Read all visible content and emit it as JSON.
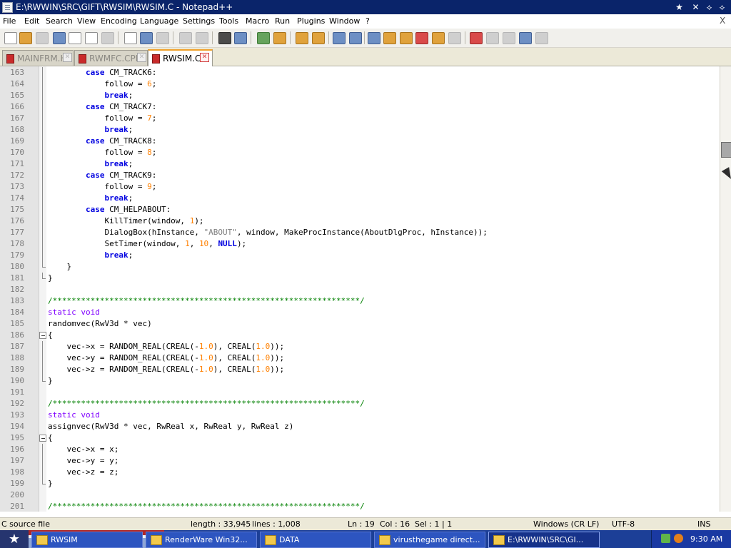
{
  "window": {
    "title": "E:\\RWWIN\\SRC\\GIFT\\RWSIM\\RWSIM.C - Notepad++",
    "controls": [
      "★",
      "✕",
      "⟡",
      "⟡",
      "✕"
    ]
  },
  "menu": {
    "items": [
      "File",
      "Edit",
      "Search",
      "View",
      "Encoding",
      "Language",
      "Settings",
      "Tools",
      "Macro",
      "Run",
      "Plugins",
      "Window",
      "?"
    ],
    "close": "X"
  },
  "toolbar": {
    "icons": [
      "new-file-icon",
      "open-file-icon",
      "save-icon",
      "save-all-icon",
      "close-icon",
      "close-all-icon",
      "print-icon",
      "cut-icon",
      "copy-icon",
      "paste-icon",
      "undo-icon",
      "redo-icon",
      "find-icon",
      "replace-icon",
      "zoom-in-icon",
      "zoom-out-icon",
      "sync-vertical-icon",
      "sync-horizontal-icon",
      "word-wrap-icon",
      "show-all-chars-icon",
      "indent-guide-icon",
      "user-lang-icon",
      "doc-map-icon",
      "function-list-icon",
      "folder-icon",
      "monitoring-icon",
      "record-macro-icon",
      "stop-macro-icon",
      "play-macro-icon",
      "run-macro-multiple-icon",
      "save-macro-icon"
    ]
  },
  "tabs": [
    {
      "label": "MAINFRM.H",
      "active": false
    },
    {
      "label": "RWMFC.CPP",
      "active": false
    },
    {
      "label": "RWSIM.C",
      "active": true
    }
  ],
  "editor": {
    "lines": [
      {
        "n": "163",
        "code": "case CM_TRACK6:"
      },
      {
        "n": "164",
        "code": "follow = 6;"
      },
      {
        "n": "165",
        "code": "break;"
      },
      {
        "n": "166",
        "code": "case CM_TRACK7:"
      },
      {
        "n": "167",
        "code": "follow = 7;"
      },
      {
        "n": "168",
        "code": "break;"
      },
      {
        "n": "169",
        "code": "case CM_TRACK8:"
      },
      {
        "n": "170",
        "code": "follow = 8;"
      },
      {
        "n": "171",
        "code": "break;"
      },
      {
        "n": "172",
        "code": "case CM_TRACK9:"
      },
      {
        "n": "173",
        "code": "follow = 9;"
      },
      {
        "n": "174",
        "code": "break;"
      },
      {
        "n": "175",
        "code": "case CM_HELPABOUT:"
      },
      {
        "n": "176",
        "code": "KillTimer(window, 1);"
      },
      {
        "n": "177",
        "code": "DialogBox(hInstance, \"ABOUT\", window, MakeProcInstance(AboutDlgProc, hInstance));"
      },
      {
        "n": "178",
        "code": "SetTimer(window, 1, 10, NULL);"
      },
      {
        "n": "179",
        "code": "break;"
      },
      {
        "n": "180",
        "code": "}"
      },
      {
        "n": "181",
        "code": "}"
      },
      {
        "n": "182",
        "code": ""
      },
      {
        "n": "183",
        "code": "/*****************************************************************/"
      },
      {
        "n": "184",
        "code": "static void"
      },
      {
        "n": "185",
        "code": "randomvec(RwV3d * vec)"
      },
      {
        "n": "186",
        "code": "{"
      },
      {
        "n": "187",
        "code": "vec->x = RANDOM_REAL(CREAL(-1.0), CREAL(1.0));"
      },
      {
        "n": "188",
        "code": "vec->y = RANDOM_REAL(CREAL(-1.0), CREAL(1.0));"
      },
      {
        "n": "189",
        "code": "vec->z = RANDOM_REAL(CREAL(-1.0), CREAL(1.0));"
      },
      {
        "n": "190",
        "code": "}"
      },
      {
        "n": "191",
        "code": ""
      },
      {
        "n": "192",
        "code": "/*****************************************************************/"
      },
      {
        "n": "193",
        "code": "static void"
      },
      {
        "n": "194",
        "code": "assignvec(RwV3d * vec, RwReal x, RwReal y, RwReal z)"
      },
      {
        "n": "195",
        "code": "{"
      },
      {
        "n": "196",
        "code": "vec->x = x;"
      },
      {
        "n": "197",
        "code": "vec->y = y;"
      },
      {
        "n": "198",
        "code": "vec->z = z;"
      },
      {
        "n": "199",
        "code": "}"
      },
      {
        "n": "200",
        "code": ""
      },
      {
        "n": "201",
        "code": "/*****************************************************************/"
      }
    ]
  },
  "status": {
    "file_type": "C source file",
    "length": "length : 33,945",
    "lines": "lines : 1,008",
    "ln": "Ln : 19",
    "col": "Col : 16",
    "sel": "Sel : 1 | 1",
    "eol": "Windows (CR LF)",
    "encoding": "UTF-8",
    "mode": "INS"
  },
  "taskbar": {
    "start_icon": "★",
    "tasks": [
      {
        "label": "RWSIM",
        "active": false
      },
      {
        "label": "RenderWare Win32...",
        "active": false
      },
      {
        "label": "DATA",
        "active": false
      },
      {
        "label": "virusthegame direct...",
        "active": false
      },
      {
        "label": "E:\\RWWIN\\SRC\\GI...",
        "active": true
      }
    ],
    "clock": "9:30 AM"
  },
  "colors": {
    "titlebar": "#0a246a",
    "keyword": "#0000e0",
    "type": "#8000ff",
    "comment": "#008000",
    "number": "#ff8000",
    "string": "#808080",
    "active_tab_top": "#f0a12a",
    "taskbar": "#1c3f97"
  }
}
